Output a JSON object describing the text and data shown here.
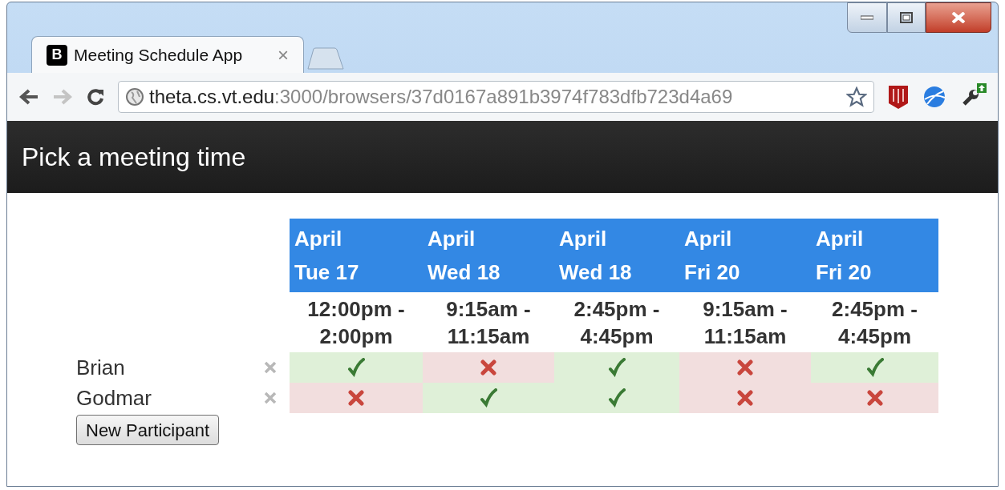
{
  "browser": {
    "tabs": [
      {
        "favicon": "B",
        "title": "Meeting Schedule App",
        "close": "×",
        "selected": true
      }
    ],
    "url_host": "theta.cs.vt.edu",
    "url_path": ":3000/browsers/37d0167a891b3974f783dfb723d4a69"
  },
  "app": {
    "title": "Pick a meeting time",
    "slots": [
      {
        "month": "April",
        "day": "Tue 17",
        "time": "12:00pm - 2:00pm"
      },
      {
        "month": "April",
        "day": "Wed 18",
        "time": "9:15am - 11:15am"
      },
      {
        "month": "April",
        "day": "Wed 18",
        "time": "2:45pm - 4:45pm"
      },
      {
        "month": "April",
        "day": "Fri 20",
        "time": "9:15am - 11:15am"
      },
      {
        "month": "April",
        "day": "Fri 20",
        "time": "2:45pm - 4:45pm"
      }
    ],
    "participants": [
      {
        "name": "Brian",
        "available": [
          true,
          false,
          true,
          false,
          true
        ]
      },
      {
        "name": "Godmar",
        "available": [
          false,
          true,
          true,
          false,
          false
        ]
      }
    ],
    "new_button": "New Participant"
  }
}
